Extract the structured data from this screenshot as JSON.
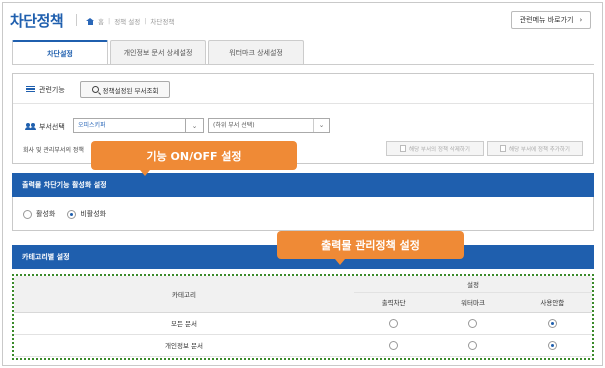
{
  "header": {
    "title": "차단정책",
    "breadcrumb": [
      "홈",
      "정책 설정",
      "차단정책"
    ],
    "related_menu_button": "관련메뉴 바로가기",
    "related_menu_chevron": "›"
  },
  "tabs": [
    {
      "label": "차단설정",
      "active": true
    },
    {
      "label": "개인정보 문서 상세설정",
      "active": false
    },
    {
      "label": "워터마크 상세설정",
      "active": false
    }
  ],
  "toolbar": {
    "related_label": "관련기능",
    "policy_dept_button": "정책설정된 부서조회",
    "dept_select_label": "부서선택",
    "dept_input_value": "오피스키퍼",
    "sub_dept_select": "(하위 부서 선택)",
    "info_text": "회사 및 관리부서의 정책",
    "delete_button": "해당 부서의 정책 삭제하기",
    "add_button": "해당 부서에 정책 추가하기"
  },
  "output_section": {
    "title": "출력물 차단기능 활성화 설정",
    "options": [
      {
        "label": "활성화",
        "selected": false
      },
      {
        "label": "비활성화",
        "selected": true
      }
    ]
  },
  "category_section": {
    "title": "카테고리별 설정",
    "columns": {
      "category": "카테고리",
      "group": "설정",
      "sub": [
        "출력차단",
        "워터마크",
        "사용안함"
      ]
    },
    "rows": [
      {
        "name": "모든 문서",
        "selected": 2
      },
      {
        "name": "개인정보 문서",
        "selected": 2
      }
    ]
  },
  "callouts": {
    "feature_toggle": "기능 ON/OFF 설정",
    "output_policy": "출력물 관리정책  설정"
  },
  "colors": {
    "brand_blue": "#1f5fae",
    "callout_orange": "#ef8a36",
    "highlight_green": "#3a8a2a"
  }
}
